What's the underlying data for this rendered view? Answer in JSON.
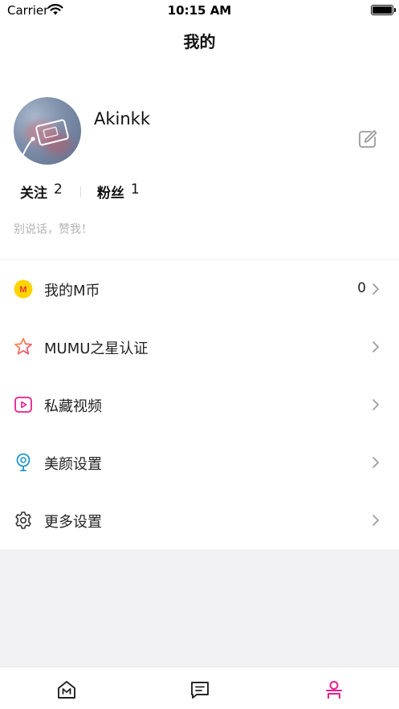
{
  "status_bar": {
    "carrier": "Carrier",
    "time": "10:15 AM"
  },
  "header": {
    "title": "我的"
  },
  "profile": {
    "username": "Akinkk",
    "following_label": "关注",
    "following_count": "2",
    "fans_label": "粉丝",
    "fans_count": "1",
    "bio": "别说话，赞我！"
  },
  "menu": [
    {
      "label": "我的M币",
      "value": "0",
      "icon": "coin-icon",
      "icon_color": "#FFD400"
    },
    {
      "label": "MUMU之星认证",
      "icon": "star-icon",
      "icon_color": "#FF6B6B"
    },
    {
      "label": "私藏视频",
      "icon": "video-icon",
      "icon_color": "#E91E8C"
    },
    {
      "label": "美颜设置",
      "icon": "beauty-icon",
      "icon_color": "#2196C9"
    },
    {
      "label": "更多设置",
      "icon": "gear-icon",
      "icon_color": "#333333"
    }
  ],
  "tab_bar": {
    "tabs": [
      {
        "name": "home",
        "icon": "home-icon",
        "active": false
      },
      {
        "name": "messages",
        "icon": "message-icon",
        "active": false
      },
      {
        "name": "profile",
        "icon": "profile-icon",
        "active": true
      }
    ],
    "active_color": "#E91E8C",
    "inactive_color": "#222222"
  }
}
